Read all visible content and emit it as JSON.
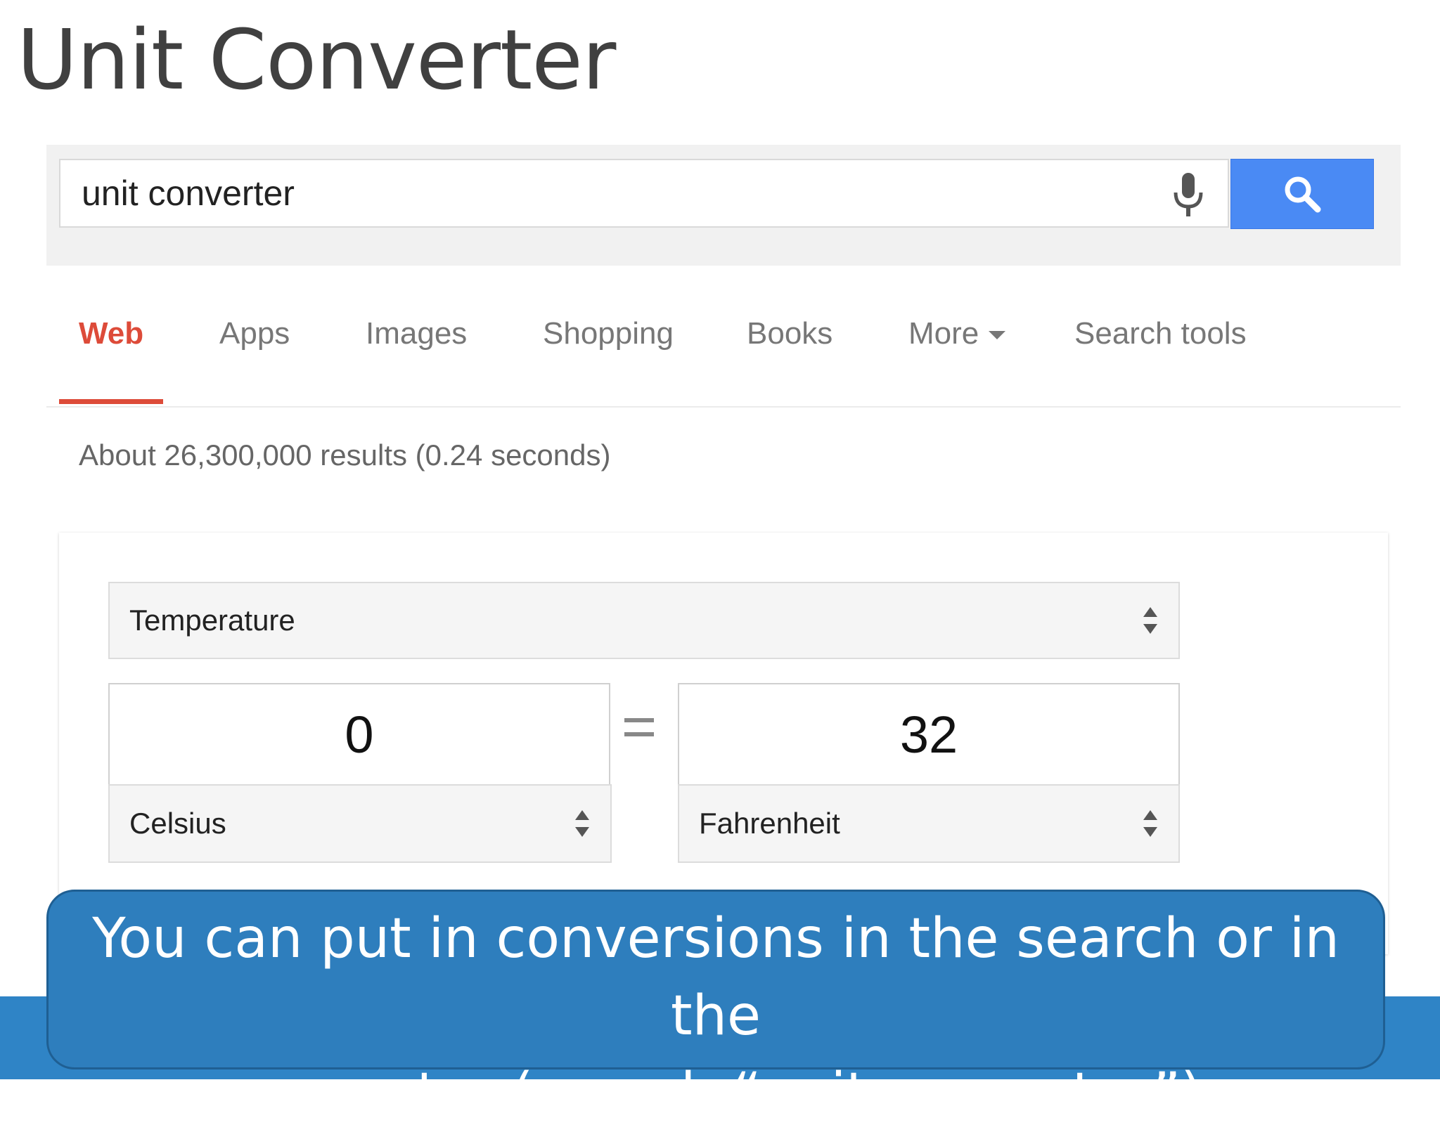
{
  "slide": {
    "title": "Unit Converter"
  },
  "search": {
    "query": "unit converter"
  },
  "tabs": [
    {
      "label": "Web",
      "active": true
    },
    {
      "label": "Apps"
    },
    {
      "label": "Images"
    },
    {
      "label": "Shopping"
    },
    {
      "label": "Books"
    },
    {
      "label": "More"
    },
    {
      "label": "Search tools"
    }
  ],
  "results": {
    "stats": "About 26,300,000 results (0.24 seconds)"
  },
  "converter": {
    "category": "Temperature",
    "from_value": "0",
    "from_unit": "Celsius",
    "to_value": "32",
    "to_unit": "Fahrenheit"
  },
  "callout": {
    "line1": "You can put in conversions in the search or in the",
    "line2": "converter (search “unit converter”)"
  },
  "colors": {
    "accent_red": "#dd4b39",
    "search_blue": "#4a8af4",
    "callout_blue": "#2e7ebd"
  }
}
